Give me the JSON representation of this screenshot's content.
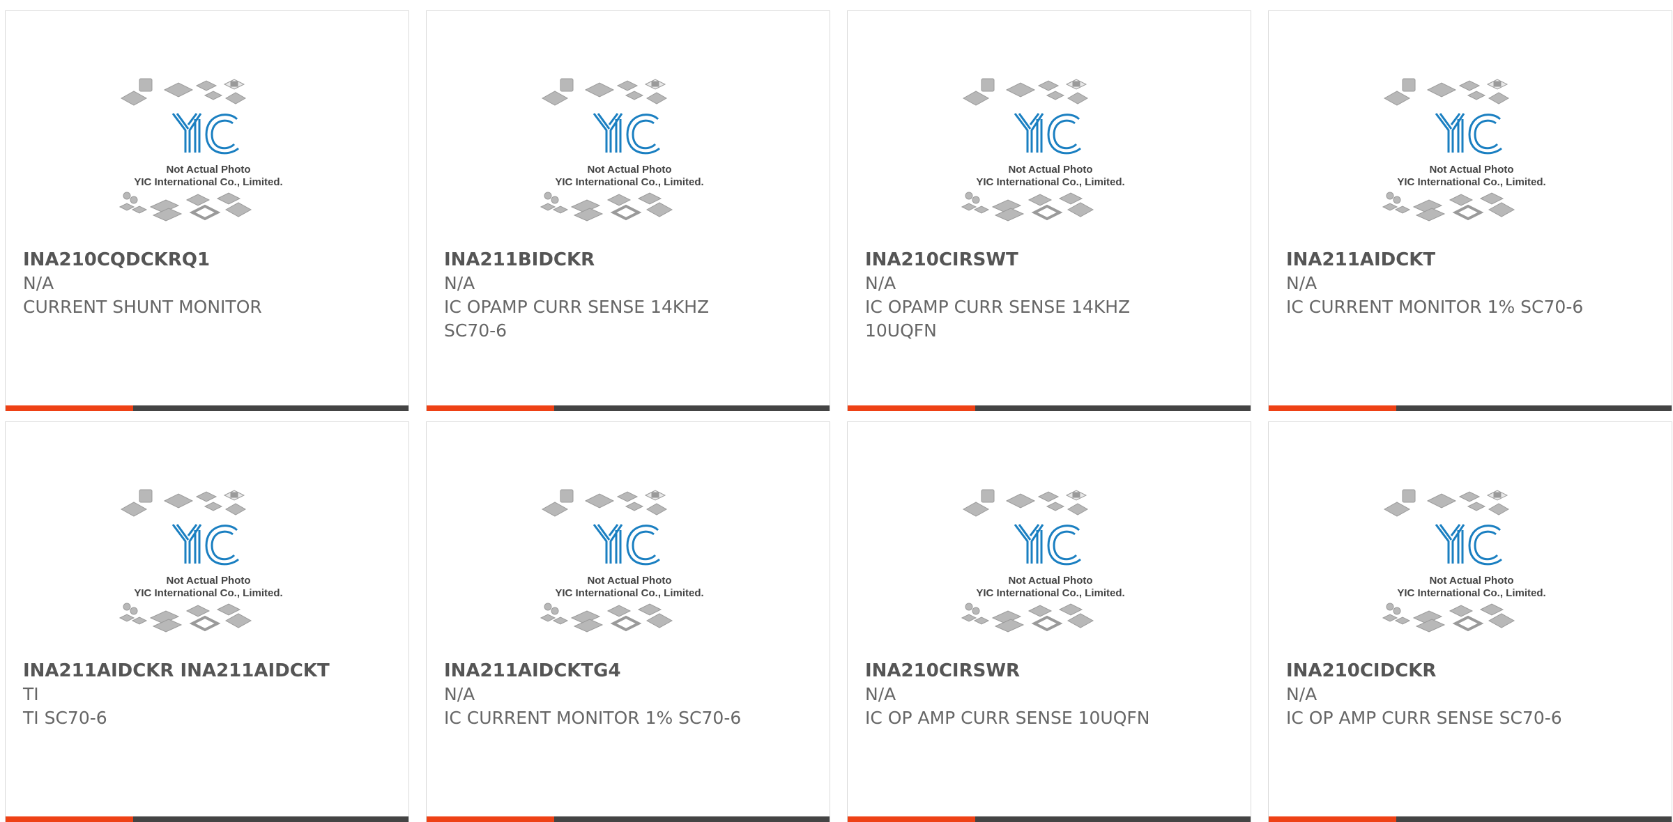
{
  "colors": {
    "accent": "#ee4115",
    "dark": "#444444",
    "text": "#555555",
    "logo_blue": "#1a7fc1",
    "chip_gray": "#b8b8b8"
  },
  "photo": {
    "caption_line1": "Not Actual Photo",
    "caption_line2": "YIC International Co., Limited.",
    "logo_icon": "yic-logo-icon"
  },
  "products": [
    {
      "part": "INA210CQDCKRQ1",
      "brand": "N/A",
      "description": "CURRENT SHUNT MONITOR"
    },
    {
      "part": "INA211BIDCKR",
      "brand": "N/A",
      "description": "IC OPAMP CURR SENSE 14KHZ SC70-6"
    },
    {
      "part": "INA210CIRSWT",
      "brand": "N/A",
      "description": "IC OPAMP CURR SENSE 14KHZ 10UQFN"
    },
    {
      "part": "INA211AIDCKT",
      "brand": "N/A",
      "description": "IC CURRENT MONITOR 1% SC70-6"
    },
    {
      "part": "INA211AIDCKR INA211AIDCKT",
      "brand": "TI",
      "description": "TI SC70-6"
    },
    {
      "part": "INA211AIDCKTG4",
      "brand": "N/A",
      "description": "IC CURRENT MONITOR 1% SC70-6"
    },
    {
      "part": "INA210CIRSWR",
      "brand": "N/A",
      "description": "IC OP AMP CURR SENSE 10UQFN"
    },
    {
      "part": "INA210CIDCKR",
      "brand": "N/A",
      "description": "IC OP AMP CURR SENSE SC70-6"
    }
  ]
}
